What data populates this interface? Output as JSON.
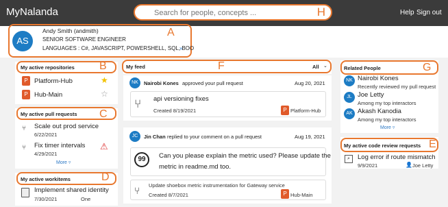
{
  "topbar": {
    "brand": "MyNalanda",
    "search_placeholder": "Search for people, concepts ...",
    "search_letter": "H",
    "help": "Help",
    "signout": "Sign out"
  },
  "profile": {
    "avatar": "AS",
    "name": "Andy Smith (andmith)",
    "title": "SENIOR SOFTWARE ENGINEER",
    "languages": "LANGUAGES : C#, JAVASCRIPT, POWERSHELL, SQL, BOO",
    "more": "»",
    "letter": "A"
  },
  "repos": {
    "title": "My active repositories",
    "letter": "B",
    "items": [
      {
        "name": "Platform-Hub",
        "starred": true
      },
      {
        "name": "Hub-Main",
        "starred": false
      }
    ]
  },
  "pulls": {
    "title": "My active pull requests",
    "letter": "C",
    "items": [
      {
        "title": "Scale out prod service",
        "date": "6/22/2021"
      },
      {
        "title": "Fix timer intervals",
        "date": "4/29/2021"
      }
    ],
    "more": "More ▿"
  },
  "workitems": {
    "title": "My active workitems",
    "letter": "D",
    "items": [
      {
        "title": "Implement shared identity",
        "date": "7/30/2021",
        "state": "One"
      }
    ]
  },
  "feed": {
    "title": "My feed",
    "filter": "All",
    "letter": "F",
    "cards": [
      {
        "avatar": "NK",
        "actor": "Nairobi Kones",
        "action": "approved your pull request",
        "date": "Aug 20, 2021",
        "item": "api versioning fixes",
        "created": "Created 8/19/2021",
        "repo": "Platform-Hub"
      },
      {
        "avatar": "JC",
        "actor": "Jin Chan",
        "action": "replied to your comment on a pull request",
        "date": "Aug 19, 2021",
        "comment_line1": "Can you please explain the metric used? Please update the",
        "comment_line2": "metric in readme.md too.",
        "item": "Update shoebox metric instrumentation for Gateway service",
        "created": "Created 8/7/2021",
        "repo": "Hub-Main"
      }
    ]
  },
  "related": {
    "title": "Related People",
    "letter": "G",
    "people": [
      {
        "avatar": "NK",
        "name": "Nairobi Kones",
        "desc": "Recently reviewed my pull request"
      },
      {
        "avatar": "JL",
        "name": "Joe Letty",
        "desc": "Among my top interactors"
      },
      {
        "avatar": "AK",
        "name": "Akash Kanodia",
        "desc": "Among my top interactors"
      }
    ],
    "more": "More ▿"
  },
  "reviews": {
    "title": "My active code review requests",
    "letter": "E",
    "items": [
      {
        "title": "Log error if route mismatch",
        "date": "9/9/2021",
        "person": "Joe Letty"
      }
    ]
  },
  "colors": {
    "accent": "#e8772e",
    "topbar": "#3b3b3b",
    "link": "#2b78c5",
    "avatar": "#1d7cc4",
    "repo": "#e05a2a"
  }
}
